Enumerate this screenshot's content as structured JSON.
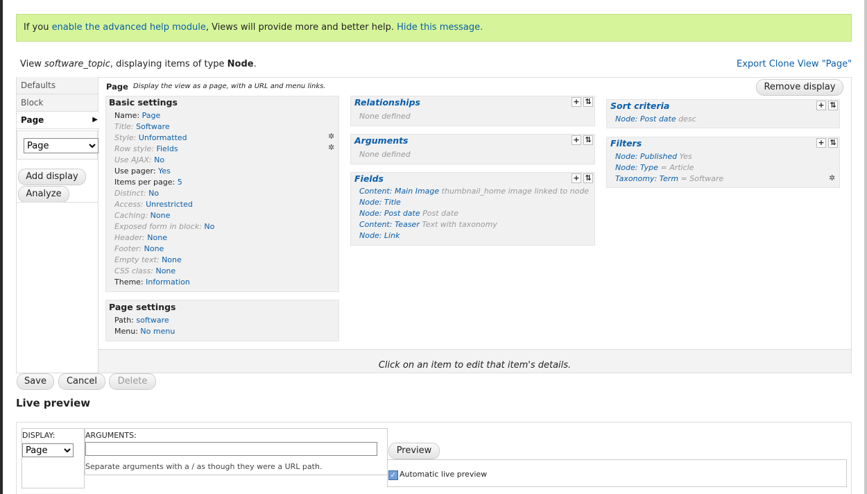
{
  "help_bar": {
    "prefix": "If you ",
    "link_enable": "enable the advanced help module",
    "middle": ", Views will provide more and better help. ",
    "link_hide": "Hide this message."
  },
  "view_info": {
    "prefix": "View ",
    "name": "software_topic",
    "middle": ", displaying items of type ",
    "type": "Node",
    "suffix": "."
  },
  "top_links": {
    "export": "Export",
    "clone": "Clone View \"Page\""
  },
  "tabs": {
    "defaults": "Defaults",
    "block": "Block",
    "page": "Page"
  },
  "left": {
    "display_select": "Page",
    "add_display": "Add display",
    "analyze": "Analyze"
  },
  "page_header": {
    "title": "Page",
    "description": "Display the view as a page, with a URL and menu links.",
    "remove": "Remove display"
  },
  "basic_settings": {
    "title": "Basic settings",
    "rows": [
      {
        "label": "Name:",
        "value": "Page"
      },
      {
        "label": "Title:",
        "value": "Software"
      },
      {
        "label": "Style:",
        "value": "Unformatted"
      },
      {
        "label": "Row style:",
        "value": "Fields"
      },
      {
        "label": "Use AJAX:",
        "value": "No"
      },
      {
        "label": "Use pager:",
        "value": "Yes"
      },
      {
        "label": "Items per page:",
        "value": "5"
      },
      {
        "label": "Distinct:",
        "value": "No"
      },
      {
        "label": "Access:",
        "value": "Unrestricted"
      },
      {
        "label": "Caching:",
        "value": "None"
      },
      {
        "label": "Exposed form in block:",
        "value": "No"
      },
      {
        "label": "Header:",
        "value": "None"
      },
      {
        "label": "Footer:",
        "value": "None"
      },
      {
        "label": "Empty text:",
        "value": "None"
      },
      {
        "label": "CSS class:",
        "value": "None"
      },
      {
        "label": "Theme:",
        "value": "Information"
      }
    ]
  },
  "page_settings": {
    "title": "Page settings",
    "rows": [
      {
        "label": "Path:",
        "value": "software"
      },
      {
        "label": "Menu:",
        "value": "No menu"
      }
    ]
  },
  "relationships": {
    "title": "Relationships",
    "empty": "None defined"
  },
  "arguments": {
    "title": "Arguments",
    "empty": "None defined"
  },
  "fields": {
    "title": "Fields",
    "rows": [
      {
        "link": "Content: Main Image",
        "extra": "thumbnail_home image linked to node"
      },
      {
        "link": "Node: Title",
        "extra": ""
      },
      {
        "link": "Node: Post date",
        "extra": "Post date"
      },
      {
        "link": "Content: Teaser",
        "extra": "Text with taxonomy"
      },
      {
        "link": "Node: Link",
        "extra": ""
      }
    ]
  },
  "sort_criteria": {
    "title": "Sort criteria",
    "rows": [
      {
        "link": "Node: Post date",
        "extra": "desc"
      }
    ]
  },
  "filters": {
    "title": "Filters",
    "rows": [
      {
        "link": "Node: Published",
        "extra": "Yes"
      },
      {
        "link": "Node: Type",
        "extra": "= Article"
      },
      {
        "link": "Taxonomy: Term",
        "extra": "= Software"
      }
    ]
  },
  "footer_hint": "Click on an item to edit that item's details.",
  "actions": {
    "save": "Save",
    "cancel": "Cancel",
    "delete": "Delete"
  },
  "live_preview": {
    "title": "Live preview",
    "display_label": "DISPLAY:",
    "display_value": "Page",
    "arguments_label": "ARGUMENTS:",
    "arguments_value": "",
    "help": "Separate arguments with a / as though they were a URL path.",
    "preview_button": "Preview",
    "auto_label": "Automatic live preview",
    "auto_checked": true
  },
  "colors": {
    "help_bg": "#d6f59a",
    "link": "#0a5ea8"
  }
}
